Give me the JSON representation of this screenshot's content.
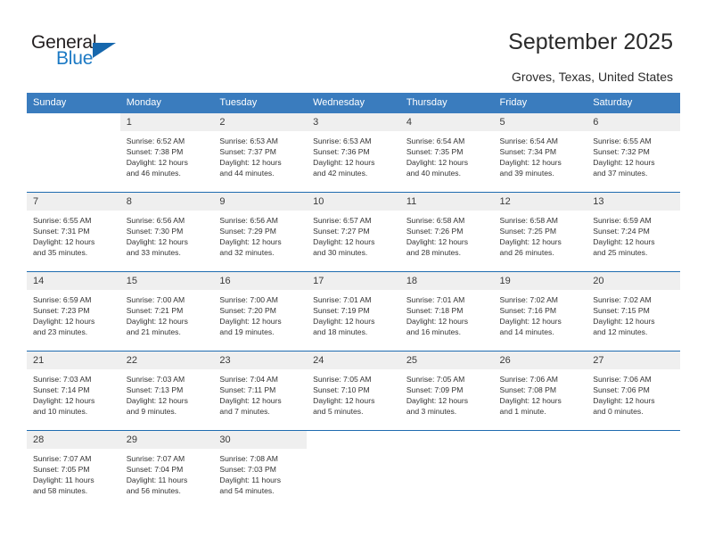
{
  "logo": {
    "word_one": "General",
    "word_two": "Blue",
    "triangle": "blue-triangle-icon"
  },
  "header": {
    "title": "September 2025",
    "location": "Groves, Texas, United States"
  },
  "calendar": {
    "weekday_headers": [
      "Sunday",
      "Monday",
      "Tuesday",
      "Wednesday",
      "Thursday",
      "Friday",
      "Saturday"
    ],
    "accent_color": "#3a7cbe",
    "rule_color": "#1f6cb0",
    "daynum_background": "#efefef",
    "weeks": [
      [
        {
          "day": "",
          "sunrise": "",
          "sunset": "",
          "daylight_line1": "",
          "daylight_line2": ""
        },
        {
          "day": "1",
          "sunrise": "Sunrise: 6:52 AM",
          "sunset": "Sunset: 7:38 PM",
          "daylight_line1": "Daylight: 12 hours",
          "daylight_line2": "and 46 minutes."
        },
        {
          "day": "2",
          "sunrise": "Sunrise: 6:53 AM",
          "sunset": "Sunset: 7:37 PM",
          "daylight_line1": "Daylight: 12 hours",
          "daylight_line2": "and 44 minutes."
        },
        {
          "day": "3",
          "sunrise": "Sunrise: 6:53 AM",
          "sunset": "Sunset: 7:36 PM",
          "daylight_line1": "Daylight: 12 hours",
          "daylight_line2": "and 42 minutes."
        },
        {
          "day": "4",
          "sunrise": "Sunrise: 6:54 AM",
          "sunset": "Sunset: 7:35 PM",
          "daylight_line1": "Daylight: 12 hours",
          "daylight_line2": "and 40 minutes."
        },
        {
          "day": "5",
          "sunrise": "Sunrise: 6:54 AM",
          "sunset": "Sunset: 7:34 PM",
          "daylight_line1": "Daylight: 12 hours",
          "daylight_line2": "and 39 minutes."
        },
        {
          "day": "6",
          "sunrise": "Sunrise: 6:55 AM",
          "sunset": "Sunset: 7:32 PM",
          "daylight_line1": "Daylight: 12 hours",
          "daylight_line2": "and 37 minutes."
        }
      ],
      [
        {
          "day": "7",
          "sunrise": "Sunrise: 6:55 AM",
          "sunset": "Sunset: 7:31 PM",
          "daylight_line1": "Daylight: 12 hours",
          "daylight_line2": "and 35 minutes."
        },
        {
          "day": "8",
          "sunrise": "Sunrise: 6:56 AM",
          "sunset": "Sunset: 7:30 PM",
          "daylight_line1": "Daylight: 12 hours",
          "daylight_line2": "and 33 minutes."
        },
        {
          "day": "9",
          "sunrise": "Sunrise: 6:56 AM",
          "sunset": "Sunset: 7:29 PM",
          "daylight_line1": "Daylight: 12 hours",
          "daylight_line2": "and 32 minutes."
        },
        {
          "day": "10",
          "sunrise": "Sunrise: 6:57 AM",
          "sunset": "Sunset: 7:27 PM",
          "daylight_line1": "Daylight: 12 hours",
          "daylight_line2": "and 30 minutes."
        },
        {
          "day": "11",
          "sunrise": "Sunrise: 6:58 AM",
          "sunset": "Sunset: 7:26 PM",
          "daylight_line1": "Daylight: 12 hours",
          "daylight_line2": "and 28 minutes."
        },
        {
          "day": "12",
          "sunrise": "Sunrise: 6:58 AM",
          "sunset": "Sunset: 7:25 PM",
          "daylight_line1": "Daylight: 12 hours",
          "daylight_line2": "and 26 minutes."
        },
        {
          "day": "13",
          "sunrise": "Sunrise: 6:59 AM",
          "sunset": "Sunset: 7:24 PM",
          "daylight_line1": "Daylight: 12 hours",
          "daylight_line2": "and 25 minutes."
        }
      ],
      [
        {
          "day": "14",
          "sunrise": "Sunrise: 6:59 AM",
          "sunset": "Sunset: 7:23 PM",
          "daylight_line1": "Daylight: 12 hours",
          "daylight_line2": "and 23 minutes."
        },
        {
          "day": "15",
          "sunrise": "Sunrise: 7:00 AM",
          "sunset": "Sunset: 7:21 PM",
          "daylight_line1": "Daylight: 12 hours",
          "daylight_line2": "and 21 minutes."
        },
        {
          "day": "16",
          "sunrise": "Sunrise: 7:00 AM",
          "sunset": "Sunset: 7:20 PM",
          "daylight_line1": "Daylight: 12 hours",
          "daylight_line2": "and 19 minutes."
        },
        {
          "day": "17",
          "sunrise": "Sunrise: 7:01 AM",
          "sunset": "Sunset: 7:19 PM",
          "daylight_line1": "Daylight: 12 hours",
          "daylight_line2": "and 18 minutes."
        },
        {
          "day": "18",
          "sunrise": "Sunrise: 7:01 AM",
          "sunset": "Sunset: 7:18 PM",
          "daylight_line1": "Daylight: 12 hours",
          "daylight_line2": "and 16 minutes."
        },
        {
          "day": "19",
          "sunrise": "Sunrise: 7:02 AM",
          "sunset": "Sunset: 7:16 PM",
          "daylight_line1": "Daylight: 12 hours",
          "daylight_line2": "and 14 minutes."
        },
        {
          "day": "20",
          "sunrise": "Sunrise: 7:02 AM",
          "sunset": "Sunset: 7:15 PM",
          "daylight_line1": "Daylight: 12 hours",
          "daylight_line2": "and 12 minutes."
        }
      ],
      [
        {
          "day": "21",
          "sunrise": "Sunrise: 7:03 AM",
          "sunset": "Sunset: 7:14 PM",
          "daylight_line1": "Daylight: 12 hours",
          "daylight_line2": "and 10 minutes."
        },
        {
          "day": "22",
          "sunrise": "Sunrise: 7:03 AM",
          "sunset": "Sunset: 7:13 PM",
          "daylight_line1": "Daylight: 12 hours",
          "daylight_line2": "and 9 minutes."
        },
        {
          "day": "23",
          "sunrise": "Sunrise: 7:04 AM",
          "sunset": "Sunset: 7:11 PM",
          "daylight_line1": "Daylight: 12 hours",
          "daylight_line2": "and 7 minutes."
        },
        {
          "day": "24",
          "sunrise": "Sunrise: 7:05 AM",
          "sunset": "Sunset: 7:10 PM",
          "daylight_line1": "Daylight: 12 hours",
          "daylight_line2": "and 5 minutes."
        },
        {
          "day": "25",
          "sunrise": "Sunrise: 7:05 AM",
          "sunset": "Sunset: 7:09 PM",
          "daylight_line1": "Daylight: 12 hours",
          "daylight_line2": "and 3 minutes."
        },
        {
          "day": "26",
          "sunrise": "Sunrise: 7:06 AM",
          "sunset": "Sunset: 7:08 PM",
          "daylight_line1": "Daylight: 12 hours",
          "daylight_line2": "and 1 minute."
        },
        {
          "day": "27",
          "sunrise": "Sunrise: 7:06 AM",
          "sunset": "Sunset: 7:06 PM",
          "daylight_line1": "Daylight: 12 hours",
          "daylight_line2": "and 0 minutes."
        }
      ],
      [
        {
          "day": "28",
          "sunrise": "Sunrise: 7:07 AM",
          "sunset": "Sunset: 7:05 PM",
          "daylight_line1": "Daylight: 11 hours",
          "daylight_line2": "and 58 minutes."
        },
        {
          "day": "29",
          "sunrise": "Sunrise: 7:07 AM",
          "sunset": "Sunset: 7:04 PM",
          "daylight_line1": "Daylight: 11 hours",
          "daylight_line2": "and 56 minutes."
        },
        {
          "day": "30",
          "sunrise": "Sunrise: 7:08 AM",
          "sunset": "Sunset: 7:03 PM",
          "daylight_line1": "Daylight: 11 hours",
          "daylight_line2": "and 54 minutes."
        },
        {
          "day": "",
          "sunrise": "",
          "sunset": "",
          "daylight_line1": "",
          "daylight_line2": ""
        },
        {
          "day": "",
          "sunrise": "",
          "sunset": "",
          "daylight_line1": "",
          "daylight_line2": ""
        },
        {
          "day": "",
          "sunrise": "",
          "sunset": "",
          "daylight_line1": "",
          "daylight_line2": ""
        },
        {
          "day": "",
          "sunrise": "",
          "sunset": "",
          "daylight_line1": "",
          "daylight_line2": ""
        }
      ]
    ]
  }
}
